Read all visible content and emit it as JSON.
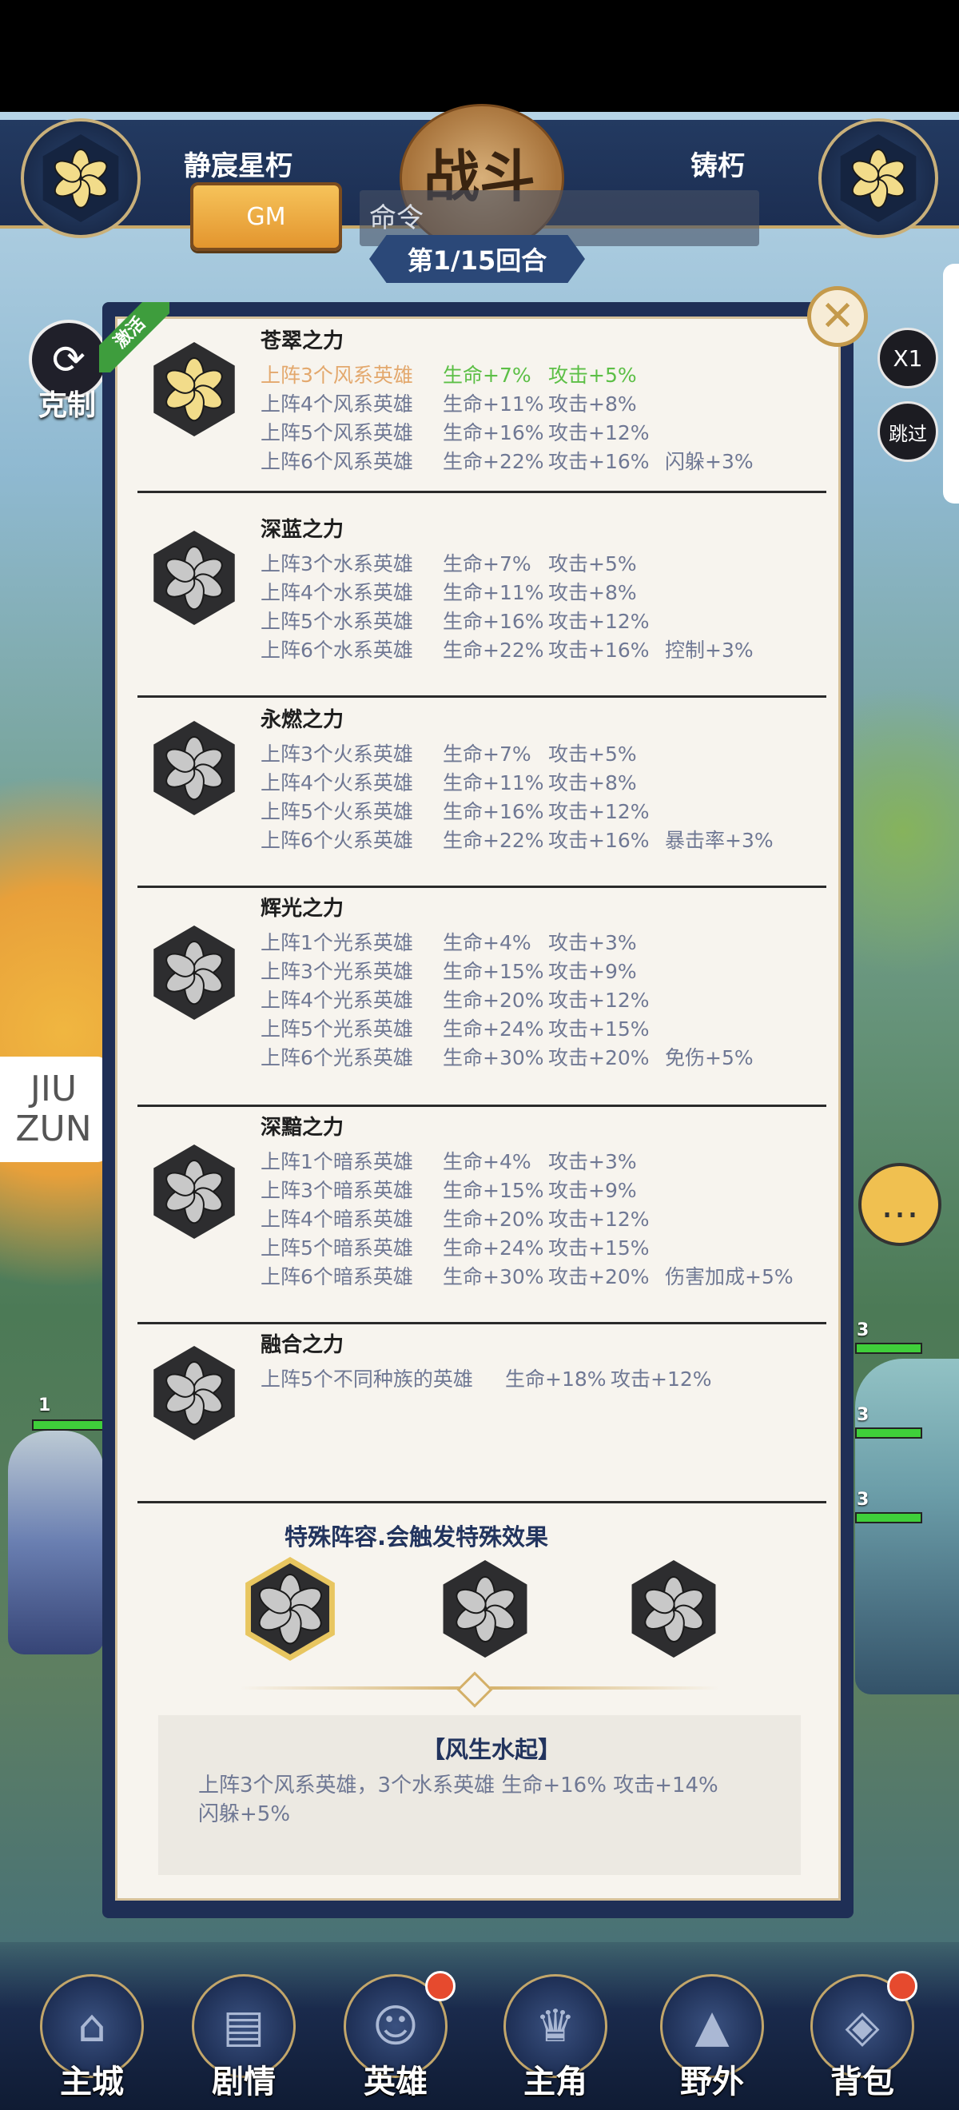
{
  "top": {
    "left_team": "静宸星朽",
    "right_team": "铸朽",
    "gm_label": "GM",
    "command_placeholder": "命令",
    "battle_title": "战斗",
    "round_label": "第1/15回合"
  },
  "side": {
    "restraint_label": "克制",
    "speed_label": "X1",
    "skip_label": "跳过",
    "watermark_line1": "JIU",
    "watermark_line2": "ZUN"
  },
  "units": {
    "left_level": "1",
    "right_levels": [
      "3",
      "3",
      "3"
    ]
  },
  "panel": {
    "active_badge": "激活",
    "close_label": "✕",
    "sections": [
      {
        "title": "苍翠之力",
        "active": true,
        "rows": [
          {
            "cond": "上阵3个风系英雄",
            "hp": "生命+7%",
            "atk": "攻击+5%",
            "extra": ""
          },
          {
            "cond": "上阵4个风系英雄",
            "hp": "生命+11%",
            "atk": "攻击+8%",
            "extra": ""
          },
          {
            "cond": "上阵5个风系英雄",
            "hp": "生命+16%",
            "atk": "攻击+12%",
            "extra": ""
          },
          {
            "cond": "上阵6个风系英雄",
            "hp": "生命+22%",
            "atk": "攻击+16%",
            "extra": "闪躲+3%"
          }
        ]
      },
      {
        "title": "深蓝之力",
        "active": false,
        "rows": [
          {
            "cond": "上阵3个水系英雄",
            "hp": "生命+7%",
            "atk": "攻击+5%",
            "extra": ""
          },
          {
            "cond": "上阵4个水系英雄",
            "hp": "生命+11%",
            "atk": "攻击+8%",
            "extra": ""
          },
          {
            "cond": "上阵5个水系英雄",
            "hp": "生命+16%",
            "atk": "攻击+12%",
            "extra": ""
          },
          {
            "cond": "上阵6个水系英雄",
            "hp": "生命+22%",
            "atk": "攻击+16%",
            "extra": "控制+3%"
          }
        ]
      },
      {
        "title": "永燃之力",
        "active": false,
        "rows": [
          {
            "cond": "上阵3个火系英雄",
            "hp": "生命+7%",
            "atk": "攻击+5%",
            "extra": ""
          },
          {
            "cond": "上阵4个火系英雄",
            "hp": "生命+11%",
            "atk": "攻击+8%",
            "extra": ""
          },
          {
            "cond": "上阵5个火系英雄",
            "hp": "生命+16%",
            "atk": "攻击+12%",
            "extra": ""
          },
          {
            "cond": "上阵6个火系英雄",
            "hp": "生命+22%",
            "atk": "攻击+16%",
            "extra": "暴击率+3%"
          }
        ]
      },
      {
        "title": "辉光之力",
        "active": false,
        "rows": [
          {
            "cond": "上阵1个光系英雄",
            "hp": "生命+4%",
            "atk": "攻击+3%",
            "extra": ""
          },
          {
            "cond": "上阵3个光系英雄",
            "hp": "生命+15%",
            "atk": "攻击+9%",
            "extra": ""
          },
          {
            "cond": "上阵4个光系英雄",
            "hp": "生命+20%",
            "atk": "攻击+12%",
            "extra": ""
          },
          {
            "cond": "上阵5个光系英雄",
            "hp": "生命+24%",
            "atk": "攻击+15%",
            "extra": ""
          },
          {
            "cond": "上阵6个光系英雄",
            "hp": "生命+30%",
            "atk": "攻击+20%",
            "extra": "免伤+5%"
          }
        ]
      },
      {
        "title": "深黯之力",
        "active": false,
        "rows": [
          {
            "cond": "上阵1个暗系英雄",
            "hp": "生命+4%",
            "atk": "攻击+3%",
            "extra": ""
          },
          {
            "cond": "上阵3个暗系英雄",
            "hp": "生命+15%",
            "atk": "攻击+9%",
            "extra": ""
          },
          {
            "cond": "上阵4个暗系英雄",
            "hp": "生命+20%",
            "atk": "攻击+12%",
            "extra": ""
          },
          {
            "cond": "上阵5个暗系英雄",
            "hp": "生命+24%",
            "atk": "攻击+15%",
            "extra": ""
          },
          {
            "cond": "上阵6个暗系英雄",
            "hp": "生命+30%",
            "atk": "攻击+20%",
            "extra": "伤害加成+5%"
          }
        ]
      },
      {
        "title": "融合之力",
        "active": false,
        "rows": [
          {
            "cond": "上阵5个不同种族的英雄",
            "hp": "生命+18%",
            "atk": "攻击+12%",
            "extra": ""
          }
        ]
      }
    ],
    "special_title": "特殊阵容.会触发特殊效果",
    "combo_name": "【风生水起】",
    "combo_desc": "上阵3个风系英雄，3个水系英雄  生命+16%   攻击+14%\n闪躲+5%"
  },
  "nav": {
    "items": [
      {
        "label": "主城",
        "badge": false
      },
      {
        "label": "剧情",
        "badge": false
      },
      {
        "label": "英雄",
        "badge": true
      },
      {
        "label": "主角",
        "badge": false
      },
      {
        "label": "野外",
        "badge": false
      },
      {
        "label": "背包",
        "badge": true
      }
    ]
  },
  "colors": {
    "active_petal": "#f2dc8a",
    "inactive_petal": "#c8c8c8",
    "active_row_condition": "#e3a86d",
    "active_row_bonus": "#5cbf46",
    "row_text": "#6f7894",
    "panel_frame": "#1f2f56",
    "badge_green": "#3e9d3d"
  }
}
